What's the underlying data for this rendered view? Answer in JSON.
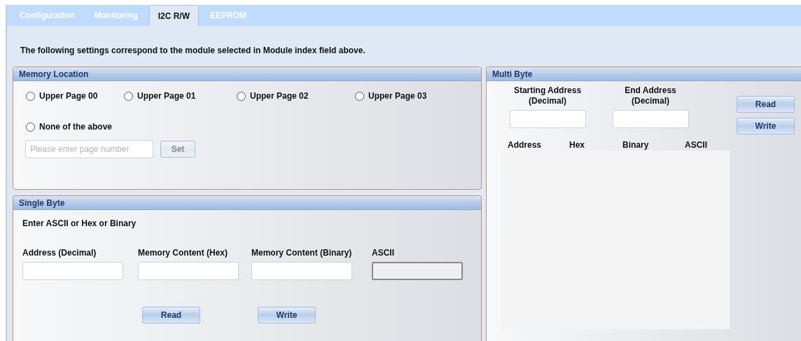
{
  "tabs": [
    {
      "label": "Configuration",
      "selected": false
    },
    {
      "label": "Monitoring",
      "selected": false
    },
    {
      "label": "I2C R/W",
      "selected": true
    },
    {
      "label": "EEPROM",
      "selected": false
    }
  ],
  "note": "The following settings correspond to the module selected in Module index field above.",
  "memory_location": {
    "title": "Memory Location",
    "options": [
      {
        "label": "Upper Page 00",
        "selected": false
      },
      {
        "label": "Upper Page 01",
        "selected": false
      },
      {
        "label": "Upper Page 02",
        "selected": false
      },
      {
        "label": "Upper Page 03",
        "selected": false
      },
      {
        "label": "None of the above",
        "selected": false
      }
    ],
    "page_field": {
      "placeholder": "Please enter page number"
    },
    "set_button": {
      "label": "Set",
      "disabled": true
    }
  },
  "single_byte": {
    "title": "Single Byte",
    "hint": "Enter ASCII or Hex or Binary",
    "fields": [
      {
        "label": "Address (Decimal)",
        "disabled": false
      },
      {
        "label": "Memory Content (Hex)",
        "disabled": false
      },
      {
        "label": "Memory Content (Binary)",
        "disabled": false
      },
      {
        "label": "ASCII",
        "disabled": true
      }
    ],
    "buttons": [
      "Read",
      "Write"
    ]
  },
  "multi_byte": {
    "title": "Multi Byte",
    "fields": [
      {
        "label": "Starting Address (Decimal)"
      },
      {
        "label": "End Address (Decimal)"
      }
    ],
    "buttons": [
      "Read",
      "Write"
    ],
    "columns": [
      "Address",
      "Hex",
      "Binary",
      "ASCII"
    ]
  }
}
